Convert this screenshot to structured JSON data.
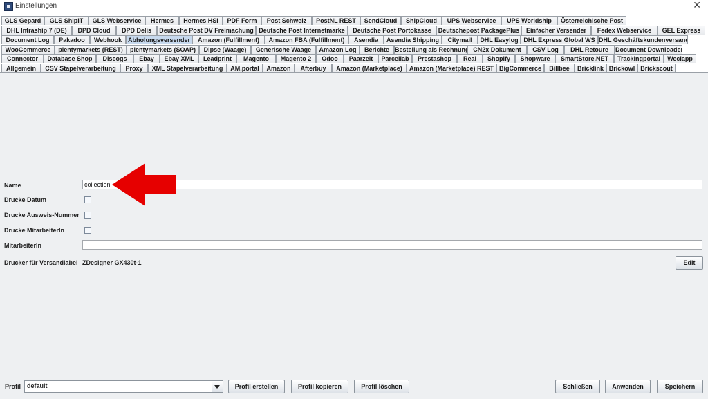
{
  "window": {
    "title": "Einstellungen",
    "close_glyph": "✕"
  },
  "tab_rows": [
    [
      "GLS Gepard",
      "GLS ShipIT",
      "GLS Webservice",
      "Hermes",
      "Hermes HSI",
      "PDF Form",
      "Post Schweiz",
      "PostNL REST",
      "SendCloud",
      "ShipCloud",
      "UPS Webservice",
      "UPS Worldship",
      "Österreichische Post"
    ],
    [
      "DHL Intraship 7 (DE)",
      "DPD Cloud",
      "DPD Delis",
      "Deutsche Post DV Freimachung",
      "Deutsche Post Internetmarke",
      "Deutsche Post Portokasse",
      "Deutschepost PackagePlus",
      "Einfacher Versender",
      "Fedex Webservice",
      "GEL Express"
    ],
    [
      "Document Log",
      "Pakadoo",
      "Webhook",
      "Abholungsversender",
      "Amazon (Fulfillment)",
      "Amazon FBA (Fulfillment)",
      "Asendia",
      "Asendia Shipping",
      "Citymail",
      "DHL Easylog",
      "DHL Express Global WS",
      "DHL Geschäftskundenversand"
    ],
    [
      "WooCommerce",
      "plentymarkets (REST)",
      "plentymarkets (SOAP)",
      "Dipse (Waage)",
      "Generische Waage",
      "Amazon Log",
      "Berichte",
      "Bestellung als Rechnung",
      "CN2x Dokument",
      "CSV Log",
      "DHL Retoure",
      "Document Downloader"
    ],
    [
      "Connector",
      "Database Shop",
      "Discogs",
      "Ebay",
      "Ebay XML",
      "Leadprint",
      "Magento",
      "Magento 2",
      "Odoo",
      "Paarzeit",
      "Parcellab",
      "Prestashop",
      "Real",
      "Shopify",
      "Shopware",
      "SmartStore.NET",
      "Trackingportal",
      "Weclapp"
    ],
    [
      "Allgemein",
      "CSV Stapelverarbeitung",
      "Proxy",
      "XML Stapelverarbeitung",
      "AM.portal",
      "Amazon",
      "Afterbuy",
      "Amazon (Marketplace)",
      "Amazon (Marketplace) REST",
      "BigCommerce",
      "Billbee",
      "Bricklink",
      "Brickowl",
      "Brickscout"
    ]
  ],
  "active_tab": "Abholungsversender",
  "form": {
    "name_label": "Name",
    "name_value": "collection",
    "drucke_datum_label": "Drucke Datum",
    "drucke_ausweis_label": "Drucke Ausweis-Nummer",
    "drucke_mitarbeiter_label": "Drucke MitarbeiterIn",
    "mitarbeiter_label": "MitarbeiterIn",
    "mitarbeiter_value": "",
    "drucker_label": "Drucker für Versandlabel",
    "drucker_value": "ZDesigner GX430t-1",
    "edit_label": "Edit",
    "checkbox_datum_checked": false,
    "checkbox_ausweis_checked": false,
    "checkbox_mitarbeiter_checked": false
  },
  "annotation": {
    "arrow_color": "#e60000",
    "arrow_icon": "red-arrow-pointing-left"
  },
  "footer": {
    "profil_label": "Profil",
    "profil_value": "default",
    "profil_erstellen": "Profil erstellen",
    "profil_kopieren": "Profil kopieren",
    "profil_loeschen": "Profil löschen",
    "schliessen": "Schließen",
    "anwenden": "Anwenden",
    "speichern": "Speichern"
  }
}
